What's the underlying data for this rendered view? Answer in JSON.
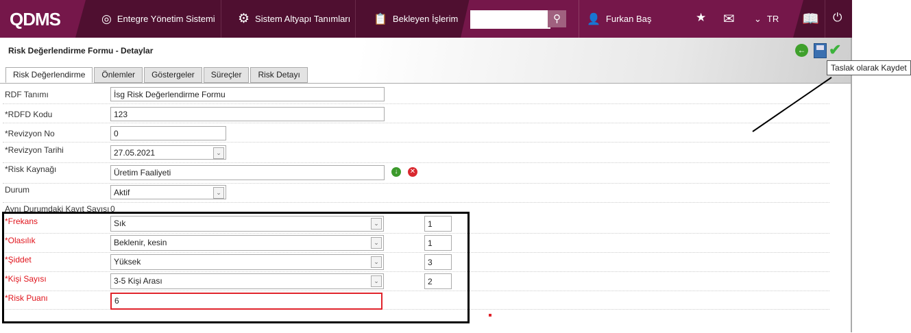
{
  "header": {
    "logo": "QDMS",
    "nav": [
      "Entegre Yönetim Sistemi",
      "Sistem Altyapı Tanımları",
      "Bekleyen İşlerim"
    ],
    "search_placeholder": "",
    "user": "Furkan Baş",
    "language": "TR"
  },
  "page": {
    "title": "Risk Değerlendirme Formu - Detaylar",
    "tooltip": "Taslak olarak Kaydet",
    "tabs": [
      "Risk Değerlendirme",
      "Önlemler",
      "Göstergeler",
      "Süreçler",
      "Risk Detayı"
    ]
  },
  "form": {
    "rdf_tanimi": {
      "label": "RDF Tanımı",
      "value": "İsg Risk Değerlendirme Formu"
    },
    "rdfd_kodu": {
      "label": "*RDFD Kodu",
      "value": "123"
    },
    "revizyon_no": {
      "label": "*Revizyon No",
      "value": "0"
    },
    "revizyon_tarihi": {
      "label": "*Revizyon Tarihi",
      "value": "27.05.2021"
    },
    "risk_kaynagi": {
      "label": "*Risk Kaynağı",
      "value": "Üretim Faaliyeti"
    },
    "durum": {
      "label": "Durum",
      "value": "Aktif"
    },
    "ayni_durum": {
      "label": "Aynı Durumdaki Kayıt Sayısı",
      "value": "0"
    },
    "frekans": {
      "label": "*Frekans",
      "value": "Sık",
      "score": "1"
    },
    "olasilik": {
      "label": "*Olasılık",
      "value": "Beklenir, kesin",
      "score": "1"
    },
    "siddet": {
      "label": "*Şiddet",
      "value": "Yüksek",
      "score": "3"
    },
    "kisi_sayisi": {
      "label": "*Kişi Sayısı",
      "value": "3-5 Kişi Arası",
      "score": "2"
    },
    "risk_puani": {
      "label": "*Risk Puanı",
      "value": "6"
    }
  }
}
